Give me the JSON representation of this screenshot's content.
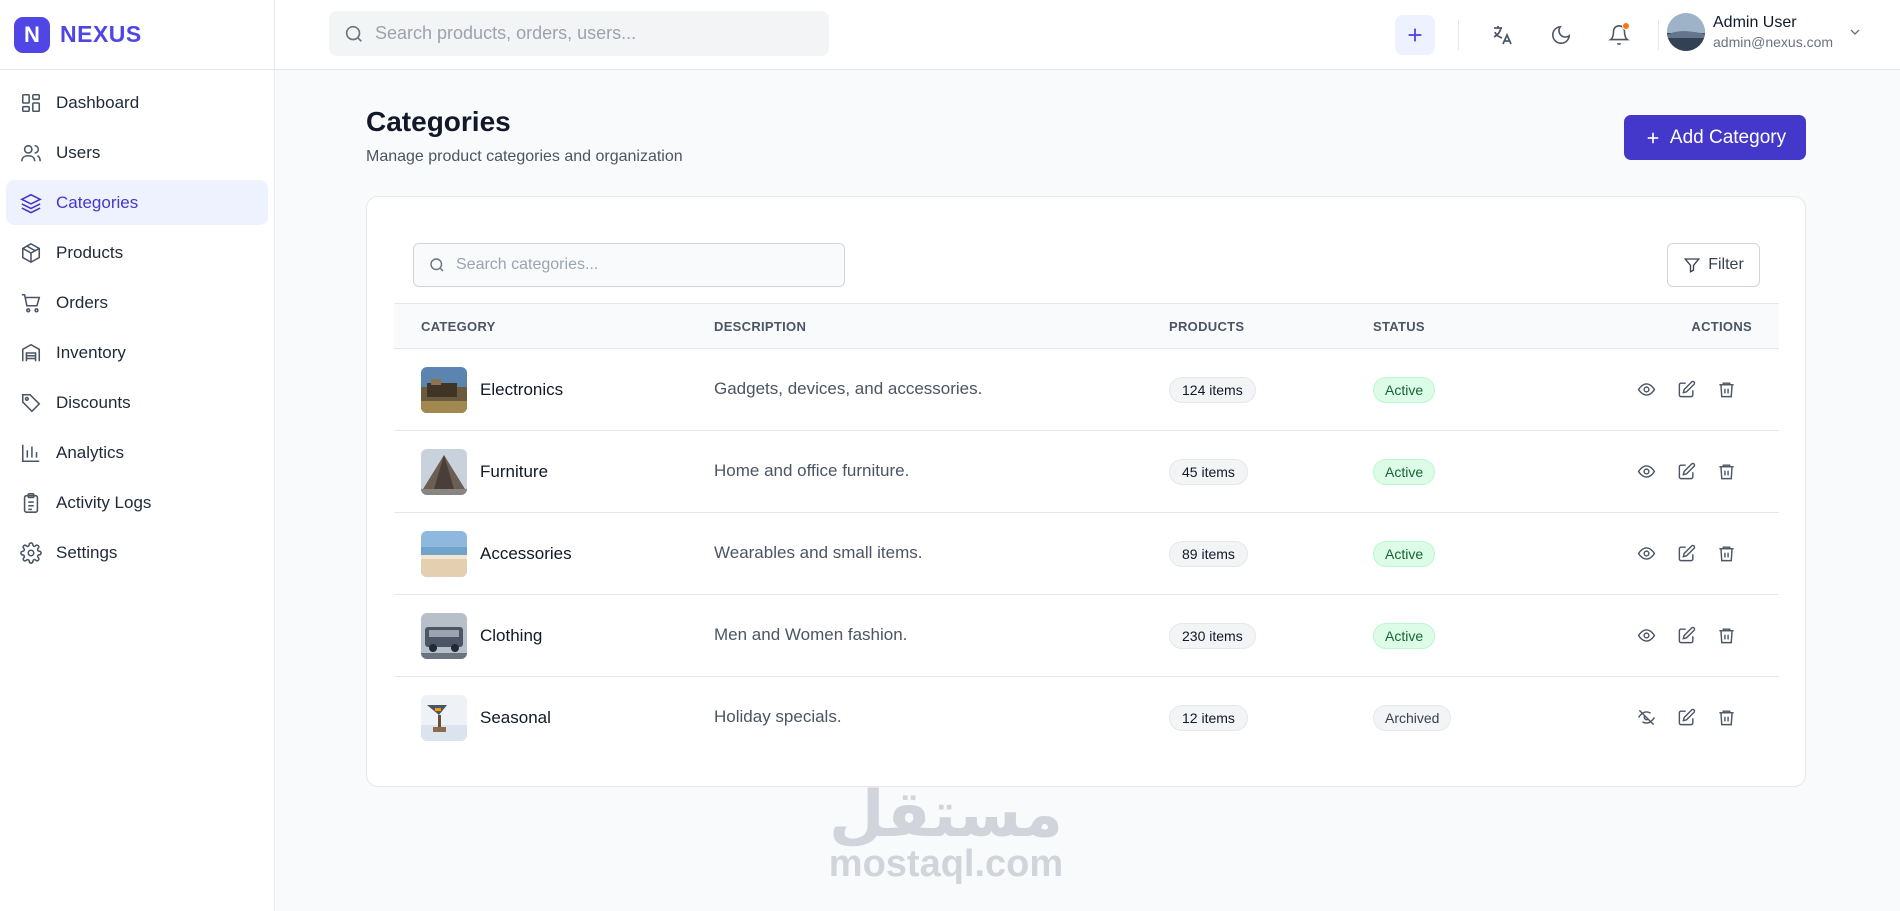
{
  "brand": {
    "mark": "N",
    "name": "NEXUS"
  },
  "sidebar": {
    "items": [
      {
        "label": "Dashboard",
        "icon": "dashboard-icon",
        "active": false
      },
      {
        "label": "Users",
        "icon": "users-icon",
        "active": false
      },
      {
        "label": "Categories",
        "icon": "layers-icon",
        "active": true
      },
      {
        "label": "Products",
        "icon": "package-icon",
        "active": false
      },
      {
        "label": "Orders",
        "icon": "cart-icon",
        "active": false
      },
      {
        "label": "Inventory",
        "icon": "warehouse-icon",
        "active": false
      },
      {
        "label": "Discounts",
        "icon": "tag-icon",
        "active": false
      },
      {
        "label": "Analytics",
        "icon": "bar-chart-icon",
        "active": false
      },
      {
        "label": "Activity Logs",
        "icon": "clipboard-icon",
        "active": false
      },
      {
        "label": "Settings",
        "icon": "gear-icon",
        "active": false
      }
    ]
  },
  "topbar": {
    "search_placeholder": "Search products, orders, users...",
    "user": {
      "name": "Admin User",
      "email": "admin@nexus.com"
    },
    "notification_dot_color": "#f97316"
  },
  "page": {
    "title": "Categories",
    "subtitle": "Manage product categories and organization",
    "add_button_label": "Add Category"
  },
  "toolbar": {
    "search_placeholder": "Search categories...",
    "filter_label": "Filter"
  },
  "table": {
    "headers": [
      "CATEGORY",
      "DESCRIPTION",
      "PRODUCTS",
      "STATUS",
      "ACTIONS"
    ],
    "rows": [
      {
        "name": "Electronics",
        "description": "Gadgets, devices, and accessories.",
        "products": "124 items",
        "status": "Active",
        "visibility": "visible"
      },
      {
        "name": "Furniture",
        "description": "Home and office furniture.",
        "products": "45 items",
        "status": "Active",
        "visibility": "visible"
      },
      {
        "name": "Accessories",
        "description": "Wearables and small items.",
        "products": "89 items",
        "status": "Active",
        "visibility": "visible"
      },
      {
        "name": "Clothing",
        "description": "Men and Women fashion.",
        "products": "230 items",
        "status": "Active",
        "visibility": "visible"
      },
      {
        "name": "Seasonal",
        "description": "Holiday specials.",
        "products": "12 items",
        "status": "Archived",
        "visibility": "hidden"
      }
    ]
  },
  "watermark": {
    "arabic": "مستقل",
    "latin": "mostaql.com"
  },
  "colors": {
    "accent": "#4f46e5",
    "active_status": "#166534",
    "active_status_bg": "#dcfce7"
  }
}
